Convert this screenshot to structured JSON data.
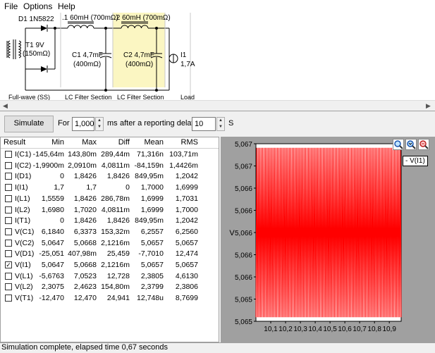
{
  "menu": {
    "file": "File",
    "options": "Options",
    "help": "Help"
  },
  "schematic": {
    "d1": "D1 1N5822",
    "t1_line1": "T1 9V",
    "t1_line2": "(150mΩ)",
    "l1": ".1 60mH (700mΩ)",
    "l2": ".2 60mH (700mΩ)",
    "c1_line1": "C1 4,7mF",
    "c1_line2": "(400mΩ)",
    "c2_line1": "C2 4,7mF",
    "c2_line2": "(400mΩ)",
    "i1_line1": "I1",
    "i1_line2": "1,7A",
    "section_fullwave": "Full-wave (SS)",
    "section_lc1": "LC Filter Section",
    "section_lc2": "LC Filter Section",
    "section_load": "Load",
    "highlight_color": "#fbf6c2"
  },
  "controls": {
    "simulate": "Simulate",
    "for_label": "For",
    "for_value": "1,000",
    "ms_label": "ms",
    "after_label": "after a reporting delay of",
    "delay_value": "10",
    "s_label": "S"
  },
  "table": {
    "headers": [
      "Result",
      "Min",
      "Max",
      "Diff",
      "Mean",
      "RMS"
    ],
    "rows": [
      {
        "name": "I(C1)",
        "checked": false,
        "min": "-145,64m",
        "max": "143,80m",
        "diff": "289,44m",
        "mean": "71,316n",
        "rms": "103,71m"
      },
      {
        "name": "I(C2)",
        "checked": false,
        "min": "-1,9900m",
        "max": "2,0910m",
        "diff": "4,0811m",
        "mean": "-84,159n",
        "rms": "1,4426m"
      },
      {
        "name": "I(D1)",
        "checked": false,
        "min": "0",
        "max": "1,8426",
        "diff": "1,8426",
        "mean": "849,95m",
        "rms": "1,2042"
      },
      {
        "name": "I(I1)",
        "checked": false,
        "min": "1,7",
        "max": "1,7",
        "diff": "0",
        "mean": "1,7000",
        "rms": "1,6999"
      },
      {
        "name": "I(L1)",
        "checked": false,
        "min": "1,5559",
        "max": "1,8426",
        "diff": "286,78m",
        "mean": "1,6999",
        "rms": "1,7031"
      },
      {
        "name": "I(L2)",
        "checked": false,
        "min": "1,6980",
        "max": "1,7020",
        "diff": "4,0811m",
        "mean": "1,6999",
        "rms": "1,7000"
      },
      {
        "name": "I(T1)",
        "checked": false,
        "min": "0",
        "max": "1,8426",
        "diff": "1,8426",
        "mean": "849,95m",
        "rms": "1,2042"
      },
      {
        "name": "V(C1)",
        "checked": false,
        "min": "6,1840",
        "max": "6,3373",
        "diff": "153,32m",
        "mean": "6,2557",
        "rms": "6,2560"
      },
      {
        "name": "V(C2)",
        "checked": false,
        "min": "5,0647",
        "max": "5,0668",
        "diff": "2,1216m",
        "mean": "5,0657",
        "rms": "5,0657"
      },
      {
        "name": "V(D1)",
        "checked": false,
        "min": "-25,051",
        "max": "407,98m",
        "diff": "25,459",
        "mean": "-7,7010",
        "rms": "12,474"
      },
      {
        "name": "V(I1)",
        "checked": true,
        "min": "5,0647",
        "max": "5,0668",
        "diff": "2,1216m",
        "mean": "5,0657",
        "rms": "5,0657"
      },
      {
        "name": "V(L1)",
        "checked": false,
        "min": "-5,6763",
        "max": "7,0523",
        "diff": "12,728",
        "mean": "2,3805",
        "rms": "4,6130"
      },
      {
        "name": "V(L2)",
        "checked": false,
        "min": "2,3075",
        "max": "2,4623",
        "diff": "154,80m",
        "mean": "2,3799",
        "rms": "2,3806"
      },
      {
        "name": "V(T1)",
        "checked": false,
        "min": "-12,470",
        "max": "12,470",
        "diff": "24,941",
        "mean": "12,748u",
        "rms": "8,7699"
      }
    ]
  },
  "chart_data": {
    "type": "line",
    "series": [
      {
        "name": "V(I1)",
        "color": "#ff0000",
        "min": 5.0647,
        "max": 5.0668,
        "x_start": 10.0,
        "x_end": 10.98,
        "cycles": 98
      }
    ],
    "ylabel": "V",
    "ytick_labels": [
      "5,067",
      "5,067",
      "5,066",
      "5,066",
      "5,066",
      "5,066",
      "5,066",
      "5,065",
      "5,065"
    ],
    "ylim": [
      5.06465,
      5.06685
    ],
    "xtick_labels": [
      "10,1",
      "10,2",
      "10,3",
      "10,4",
      "10,5",
      "10,6",
      "10,7",
      "10,8",
      "10,9"
    ],
    "x_ticks": [
      10.1,
      10.2,
      10.3,
      10.4,
      10.5,
      10.6,
      10.7,
      10.8,
      10.9
    ],
    "xlim": [
      10.0,
      10.98
    ],
    "legend": "- V(I1)",
    "legend_position": "top-right"
  },
  "plot_tools": [
    "zoom-in-icon",
    "zoom-to-fit-icon",
    "zoom-out-icon"
  ],
  "status": "Simulation complete, elapsed time 0,67 seconds"
}
